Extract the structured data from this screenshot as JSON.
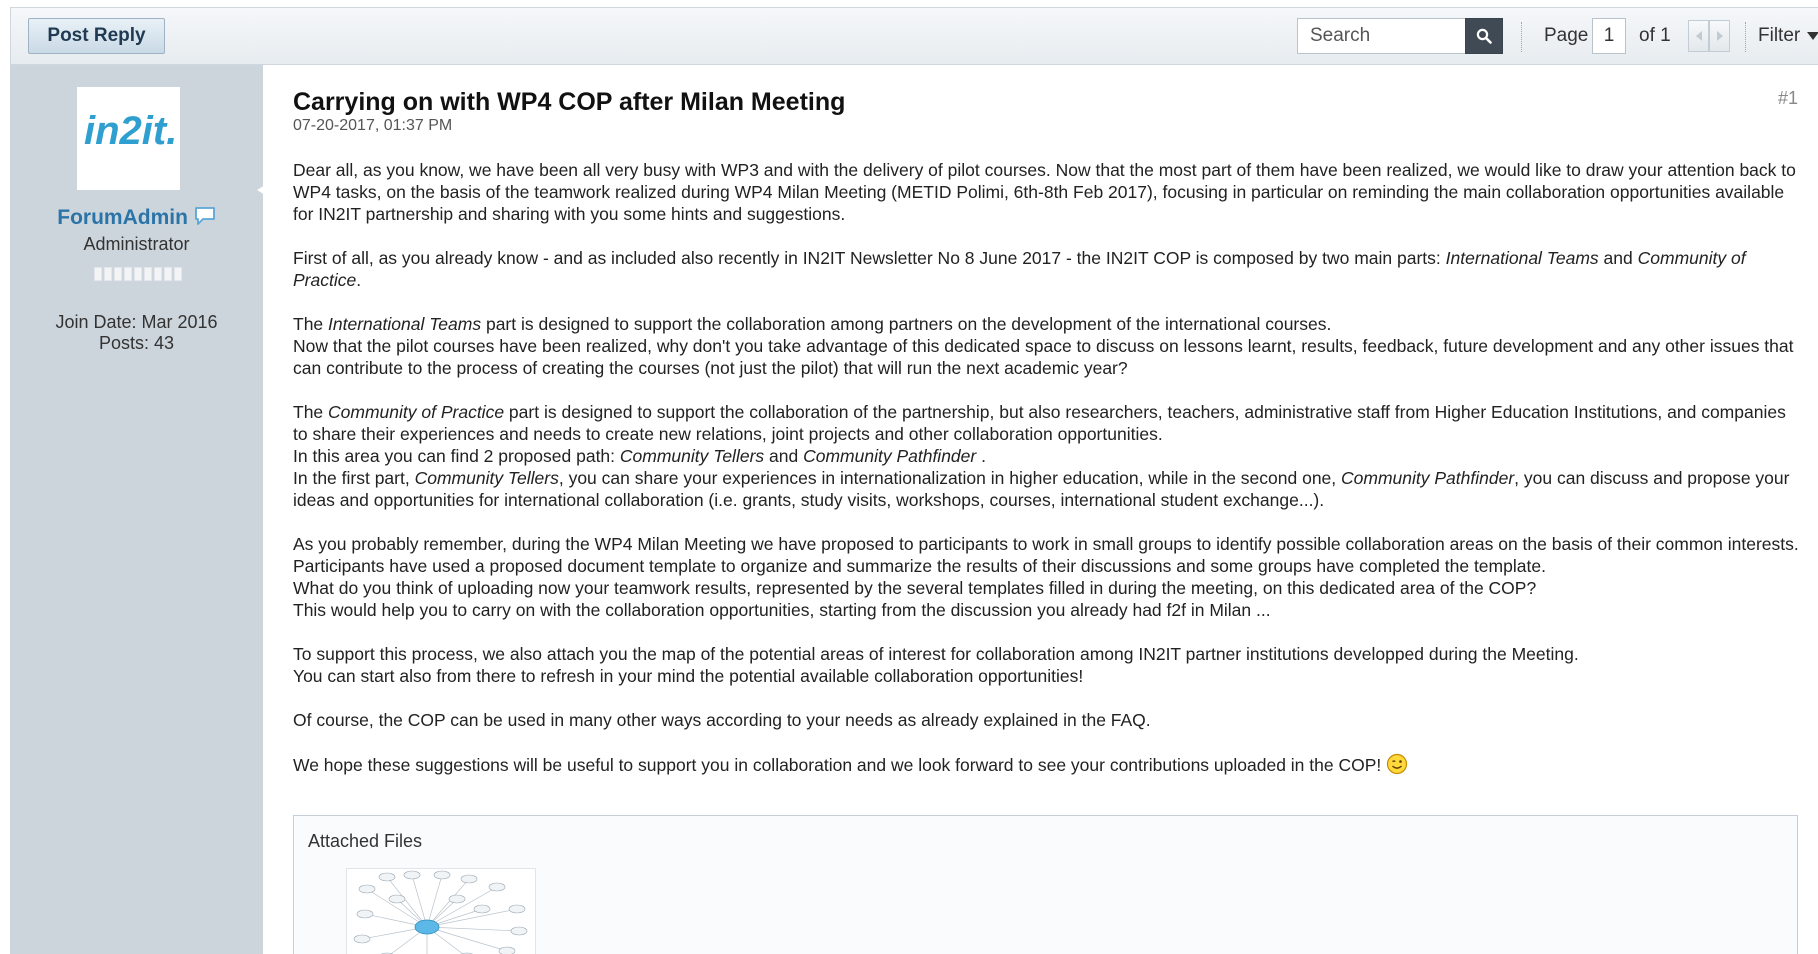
{
  "toolbar": {
    "post_reply_label": "Post Reply",
    "search_placeholder": "Search",
    "page_label": "Page",
    "page_value": "1",
    "page_of": "of 1",
    "filter_label": "Filter"
  },
  "user": {
    "avatar_text": "in2it.",
    "name": "ForumAdmin",
    "title": "Administrator",
    "join_date": "Join Date: Mar 2016",
    "posts": "Posts: 43"
  },
  "post": {
    "title": "Carrying on with WP4 COP after Milan Meeting",
    "date": "07-20-2017, 01:37 PM",
    "number": "#1",
    "attached_files_label": "Attached Files"
  },
  "body": {
    "p1": "Dear all, as you know, we have been all very busy with WP3 and with the delivery of pilot courses. Now that the most part of them have been realized, we would like to draw your attention back to WP4 tasks, on the basis of the teamwork realized during WP4 Milan Meeting (METID Polimi, 6th-8th Feb 2017), focusing in particular on reminding the main collaboration opportunities available for IN2IT partnership and sharing with you some hints and suggestions.",
    "p2_a": "First of all, as you already know - and as included also recently in IN2IT Newsletter No 8 June 2017 - the IN2IT COP is composed by two main parts: ",
    "p2_em1": "International Teams",
    "p2_b": " and ",
    "p2_em2": "Community of Practice",
    "p2_c": ".",
    "p3_a": "The ",
    "p3_em": "International Teams",
    "p3_b": " part is designed to support the collaboration among partners on the development of the international courses.",
    "p3_c": "Now that the pilot courses have been realized, why don't you take advantage of this dedicated space to discuss on lessons learnt, results, feedback, future development and any other issues that can contribute to the process of creating the courses (not just the pilot) that will run the next academic year?",
    "p4_a": "The ",
    "p4_em": "Community of Practice",
    "p4_b": " part is designed to support the collaboration of the partnership, but also researchers, teachers, administrative staff from Higher Education Institutions, and companies to share their experiences and needs to create new relations, joint projects and other collaboration opportunities.",
    "p4_c": "In this area you can find 2 proposed path: ",
    "p4_em2": "Community Tellers",
    "p4_d": " and ",
    "p4_em3": "Community Pathfinder",
    "p4_e": " .",
    "p4_f": "In the first part, ",
    "p4_em4": "Community Tellers",
    "p4_g": ", you can share your experiences in internationalization in higher education, while in the second one, ",
    "p4_em5": "Community Pathfinder",
    "p4_h": ", you can discuss and propose your ideas and opportunities for international collaboration (i.e. grants, study visits, workshops, courses, international student exchange...).",
    "p5_a": "As you probably remember, during the WP4 Milan Meeting we have proposed to participants to work in small groups to identify possible collaboration areas on the basis of their common interests. Participants have used a proposed document template to organize and summarize the results of their discussions and some groups have completed the template.",
    "p5_b": "What do you think of uploading now your teamwork results, represented by the several templates filled in during the meeting, on this dedicated area of the COP?",
    "p5_c": "This would help you to carry on with the collaboration opportunities, starting from the discussion you already had f2f in Milan ...",
    "p6_a": "To support this process, we also attach you the map of the potential areas of interest for collaboration among IN2IT partner institutions developped during the Meeting.",
    "p6_b": "You can start also from there to refresh in your mind the potential available collaboration opportunities!",
    "p7": "Of course, the COP can be used in many other ways according to your needs as already explained in the FAQ.",
    "p8": "We hope these suggestions will be useful to support you in collaboration and we look forward to see your contributions uploaded in the COP!"
  },
  "colors": {
    "accent": "#2b74a8",
    "sidebar_bg": "#cdd5dc",
    "toolbar_bg": "#e7ecf0",
    "search_button": "#3f4a55"
  },
  "icons": [
    "search-icon",
    "chat-bubble-icon",
    "chevron-left-icon",
    "chevron-right-icon",
    "caret-down-icon",
    "wink-smiley-icon"
  ]
}
